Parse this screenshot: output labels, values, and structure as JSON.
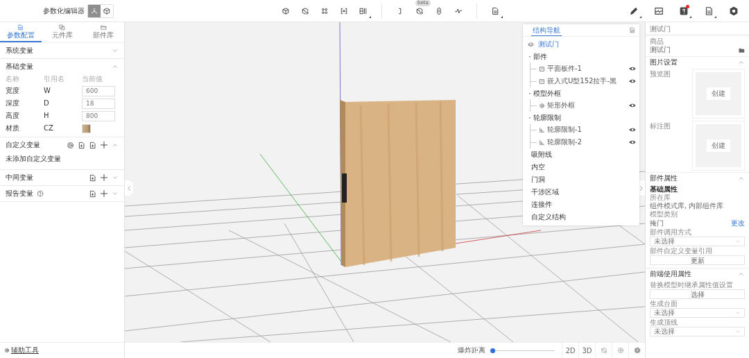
{
  "header": {
    "title": "参数化编辑器",
    "view_modes": [
      {
        "kind": "axes",
        "selected": true
      },
      {
        "kind": "cube",
        "selected": false
      }
    ],
    "beta_badge": "beta",
    "notification": true
  },
  "left_tabs": [
    {
      "kind": "doc",
      "label": "参数配置",
      "selected": true
    },
    {
      "kind": "copy",
      "label": "元件库",
      "selected": false
    },
    {
      "kind": "folder",
      "label": "部件库",
      "selected": false
    }
  ],
  "variable_sections": [
    {
      "kind": "system",
      "title": "系统变量",
      "expanded": false
    },
    {
      "kind": "basic",
      "title": "基础变量",
      "expanded": true,
      "columns": [
        "名称",
        "引用名",
        "当前值"
      ],
      "rows": [
        {
          "kind": "number",
          "name": "宽度",
          "ref": "W",
          "value": "600"
        },
        {
          "kind": "number",
          "name": "深度",
          "ref": "D",
          "value": "18"
        },
        {
          "kind": "number",
          "name": "高度",
          "ref": "H",
          "value": "800"
        },
        {
          "kind": "material",
          "name": "材质",
          "ref": "CZ"
        }
      ]
    },
    {
      "kind": "custom",
      "title": "自定义变量",
      "expanded": true,
      "empty_text": "未添加自定义变量"
    },
    {
      "kind": "middle",
      "title": "中间变量",
      "expanded": false
    },
    {
      "kind": "report",
      "title": "报告变量",
      "expanded": false
    }
  ],
  "footer_tool": "辅助工具",
  "structure_nav": {
    "tab": "结构导航",
    "root": "测试门",
    "groups": [
      {
        "label": "部件",
        "expanded": true,
        "children": [
          {
            "kind": "panel",
            "label": "平面板件-1",
            "visible": true
          },
          {
            "kind": "panel",
            "label": "嵌入式U型152拉手-黑",
            "visible": true
          }
        ]
      },
      {
        "label": "模型外框",
        "expanded": true,
        "children": [
          {
            "kind": "frame",
            "label": "矩形外框",
            "visible": true
          }
        ]
      },
      {
        "label": "轮廓限制",
        "expanded": true,
        "children": [
          {
            "kind": "contour",
            "label": "轮廓限制-1",
            "visible": true
          },
          {
            "kind": "contour",
            "label": "轮廓限制-2",
            "visible": true
          }
        ]
      }
    ],
    "categories": [
      "吸附线",
      "内空",
      "门洞",
      "干涉区域",
      "连接件",
      "自定义结构"
    ]
  },
  "properties": {
    "title": "测试门",
    "product_label": "商品",
    "product_value": "测试门",
    "image_settings": {
      "title": "图片设置",
      "expanded": true,
      "slots": [
        {
          "label": "预览图",
          "button": "创建"
        },
        {
          "label": "标注图",
          "button": "创建"
        }
      ]
    },
    "part_props": {
      "title": "部件属性",
      "expanded": true,
      "subtitle": "基础属性",
      "library_label": "所在库",
      "library_value": "组件模式库, 内部组件库",
      "type_label": "模型类别",
      "type_value": "掩门",
      "change_link": "更改",
      "call_label": "部件调用方式",
      "call_select": "未选择",
      "ref_label": "部件自定义变量引用",
      "ref_button": "更新"
    },
    "frontend_props": {
      "title": "前端使用属性",
      "expanded": true,
      "inherit_label": "替换模型时继承属性值设置",
      "inherit_button": "选择",
      "top_label": "生成台面",
      "top_select": "未选择",
      "line_label": "生成顶线",
      "line_select": "未选择"
    }
  },
  "bottom_bar": {
    "explode_label": "爆炸距离",
    "explode": {
      "level": 0
    },
    "view_buttons": [
      "2D",
      "3D"
    ]
  }
}
